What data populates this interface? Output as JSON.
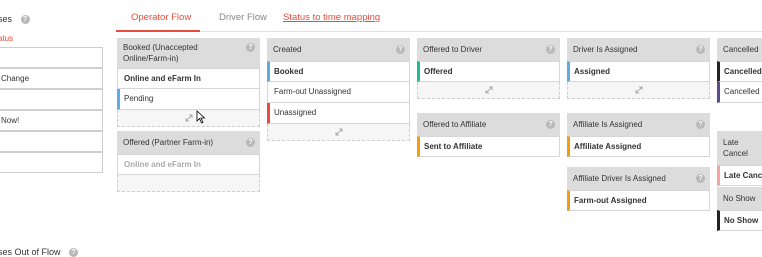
{
  "left_panel": {
    "title": "ses",
    "status_label": "atus",
    "boxes": [
      "",
      "Change",
      "",
      "Now!",
      "",
      ""
    ],
    "bottom_title": "ses Out of Flow"
  },
  "tabs": [
    {
      "label": "Operator Flow",
      "active": true
    },
    {
      "label": "Driver Flow",
      "active": false
    },
    {
      "label": "Status to time mapping",
      "active": false,
      "link": true
    }
  ],
  "colors": {
    "accent": "#e74c3c",
    "blue": "#5dade2",
    "green": "#1abc9c",
    "orange": "#f39c12",
    "red": "#e74c3c",
    "purple": "#5b4b8a",
    "pink": "#f5a3a3",
    "black": "#222222"
  },
  "groups": {
    "booked": {
      "title": "Booked (Unaccepted Online/Farm-in)",
      "cards": [
        "Online and eFarm In",
        "Pending"
      ]
    },
    "offered_partner": {
      "title": "Offered (Partner Farm-in)",
      "cards": [
        "Online and eFarm In"
      ]
    },
    "created": {
      "title": "Created",
      "cards": [
        "Booked",
        "Farm-out Unassigned",
        "Unassigned"
      ]
    },
    "offered_driver": {
      "title": "Offered to Driver",
      "cards": [
        "Offered"
      ]
    },
    "offered_affiliate": {
      "title": "Offered to Affiliate",
      "cards": [
        "Sent to Affiliate"
      ]
    },
    "driver_assigned": {
      "title": "Driver Is Assigned",
      "cards": [
        "Assigned"
      ]
    },
    "affiliate_assigned": {
      "title": "Affiliate Is Assigned",
      "cards": [
        "Affiliate Assigned"
      ]
    },
    "affiliate_driver_assigned": {
      "title": "Affiliate Driver Is Assigned",
      "cards": [
        "Farm-out Assigned"
      ]
    },
    "cancelled": {
      "title": "Cancelled",
      "cards": [
        "Cancelled",
        "Cancelled b"
      ]
    },
    "late_cancel": {
      "title": "Late Cancel",
      "cards": [
        "Late Cance"
      ]
    },
    "no_show": {
      "title": "No Show",
      "cards": [
        "No Show"
      ]
    }
  },
  "icons": {
    "help": "?",
    "expand": "expand-icon",
    "cursor": "pointer-cursor"
  }
}
